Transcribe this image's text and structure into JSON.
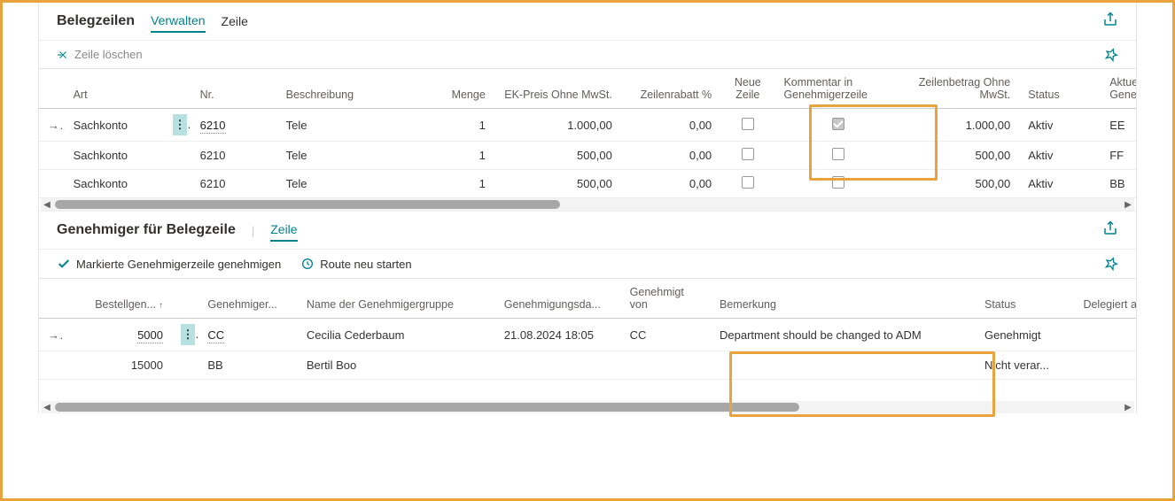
{
  "section1": {
    "title": "Belegzeilen",
    "tabs": {
      "manage": "Verwalten",
      "line": "Zeile"
    },
    "toolbar": {
      "deleteLine": "Zeile löschen"
    },
    "columns": {
      "art": "Art",
      "nr": "Nr.",
      "beschreibung": "Beschreibung",
      "menge": "Menge",
      "ekpreis": "EK-Preis Ohne MwSt.",
      "zeilenrabatt": "Zeilenrabatt %",
      "neueZeile": "Neue Zeile",
      "kommentar": "Kommentar in Genehmigerzeile",
      "zeilenbetrag": "Zeilenbetrag Ohne MwSt.",
      "status": "Status",
      "aktueller": "Aktueller Genehm"
    },
    "rows": [
      {
        "art": "Sachkonto",
        "nr": "6210",
        "beschreibung": "Tele",
        "menge": "1",
        "ekpreis": "1.000,00",
        "zeilenrabatt": "0,00",
        "neueZeile": false,
        "kommentar": true,
        "zeilenbetrag": "1.000,00",
        "status": "Aktiv",
        "aktueller": "EE"
      },
      {
        "art": "Sachkonto",
        "nr": "6210",
        "beschreibung": "Tele",
        "menge": "1",
        "ekpreis": "500,00",
        "zeilenrabatt": "0,00",
        "neueZeile": false,
        "kommentar": false,
        "zeilenbetrag": "500,00",
        "status": "Aktiv",
        "aktueller": "FF"
      },
      {
        "art": "Sachkonto",
        "nr": "6210",
        "beschreibung": "Tele",
        "menge": "1",
        "ekpreis": "500,00",
        "zeilenrabatt": "0,00",
        "neueZeile": false,
        "kommentar": false,
        "zeilenbetrag": "500,00",
        "status": "Aktiv",
        "aktueller": "BB"
      }
    ]
  },
  "section2": {
    "title": "Genehmiger für Belegzeile",
    "tabs": {
      "line": "Zeile"
    },
    "toolbar": {
      "approve": "Markierte Genehmigerzeile genehmigen",
      "restart": "Route neu starten"
    },
    "columns": {
      "bestellgen": "Bestellgen...",
      "genehmiger": "Genehmiger...",
      "gruppenname": "Name der Genehmigergruppe",
      "datum": "Genehmigungsda...",
      "von": "Genehmigt von",
      "bemerkung": "Bemerkung",
      "status": "Status",
      "delegiert": "Delegiert an"
    },
    "rows": [
      {
        "bestellgen": "5000",
        "genehmiger": "CC",
        "gruppenname": "Cecilia Cederbaum",
        "datum": "21.08.2024 18:05",
        "von": "CC",
        "bemerkung": "Department should be changed to ADM",
        "status": "Genehmigt",
        "delegiert": ""
      },
      {
        "bestellgen": "15000",
        "genehmiger": "BB",
        "gruppenname": "Bertil Boo",
        "datum": "",
        "von": "",
        "bemerkung": "",
        "status": "Nicht verar...",
        "delegiert": ""
      }
    ]
  }
}
